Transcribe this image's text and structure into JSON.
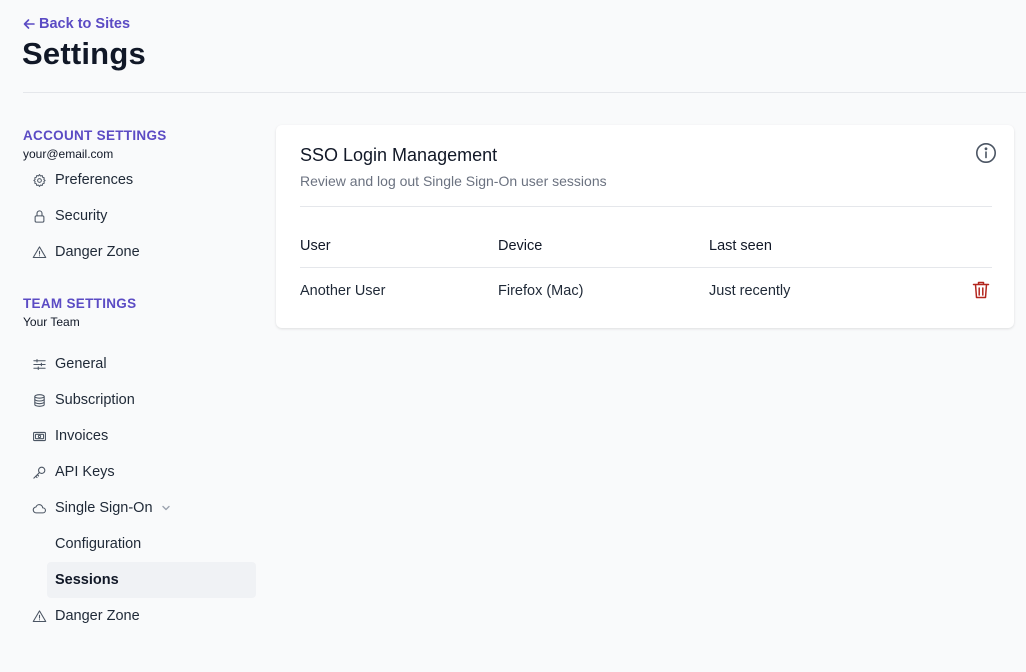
{
  "header": {
    "back_label": "Back to Sites",
    "title": "Settings"
  },
  "sidebar": {
    "account": {
      "title": "ACCOUNT SETTINGS",
      "email": "your@email.com",
      "items": [
        {
          "label": "Preferences",
          "icon": "gear-icon"
        },
        {
          "label": "Security",
          "icon": "lock-icon"
        },
        {
          "label": "Danger Zone",
          "icon": "warning-icon"
        }
      ]
    },
    "team": {
      "title": "TEAM SETTINGS",
      "name": "Your Team",
      "items": [
        {
          "label": "General",
          "icon": "sliders-icon"
        },
        {
          "label": "Subscription",
          "icon": "database-icon"
        },
        {
          "label": "Invoices",
          "icon": "banknote-icon"
        },
        {
          "label": "API Keys",
          "icon": "key-icon"
        },
        {
          "label": "Single Sign-On",
          "icon": "cloud-icon",
          "expanded": true
        },
        {
          "label": "Danger Zone",
          "icon": "warning-icon"
        }
      ],
      "sso_subitems": [
        {
          "label": "Configuration",
          "active": false
        },
        {
          "label": "Sessions",
          "active": true
        }
      ]
    }
  },
  "card": {
    "title": "SSO Login Management",
    "subtitle": "Review and log out Single Sign-On user sessions",
    "columns": [
      "User",
      "Device",
      "Last seen"
    ],
    "rows": [
      {
        "user": "Another User",
        "device": "Firefox (Mac)",
        "last_seen": "Just recently"
      }
    ]
  },
  "colors": {
    "accent": "#5b4bc4",
    "danger": "#b3261e",
    "background": "#f9fafb",
    "active_item_bg": "#f0f2f5"
  }
}
